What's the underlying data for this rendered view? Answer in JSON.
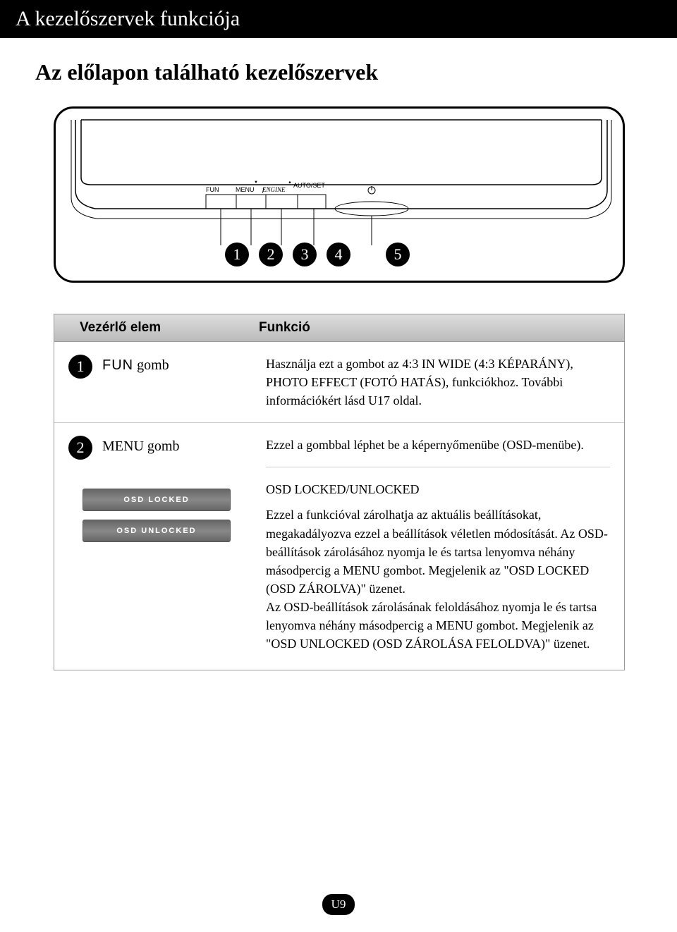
{
  "header_title": "A kezelőszervek funkciója",
  "subtitle": "Az előlapon található kezelőszervek",
  "monitor": {
    "btn_fun": "FUN",
    "btn_menu": "MENU",
    "btn_engine": "ENGINE",
    "btn_down": "▼",
    "btn_up": "▲",
    "btn_auto": "AUTO/SET",
    "c1": "1",
    "c2": "2",
    "c3": "3",
    "c4": "4",
    "c5": "5"
  },
  "table": {
    "th_control": "Vezérlő elem",
    "th_function": "Funkció",
    "row1": {
      "num": "1",
      "label_prefix": "FUN",
      "label": " gomb",
      "desc": "Használja ezt a gombot az 4:3 IN WIDE (4:3 KÉPARÁNY), PHOTO EFFECT (FOTÓ HATÁS), funkciókhoz. További információkért lásd U17 oldal."
    },
    "row2": {
      "num": "2",
      "label": "MENU gomb",
      "desc": "Ezzel a gombbal léphet be a képernyőmenübe (OSD-menübe).",
      "osd_title": "OSD LOCKED/UNLOCKED",
      "badge_locked": "OSD LOCKED",
      "badge_unlocked": "OSD UNLOCKED",
      "osd_text": "Ezzel a funkcióval zárolhatja az aktuális beállításokat, megakadályozva ezzel a beállítások véletlen módosítását. Az OSD-beállítások zárolásához nyomja le és tartsa lenyomva néhány másodpercig a MENU gombot. Megjelenik az \"OSD LOCKED (OSD ZÁROLVA)\" üzenet.\nAz OSD-beállítások zárolásának feloldásához nyomja le és tartsa lenyomva néhány másodpercig a MENU gombot. Megjelenik az \"OSD UNLOCKED (OSD ZÁROLÁSA FELOLDVA)\" üzenet."
    }
  },
  "page_number": "U9"
}
